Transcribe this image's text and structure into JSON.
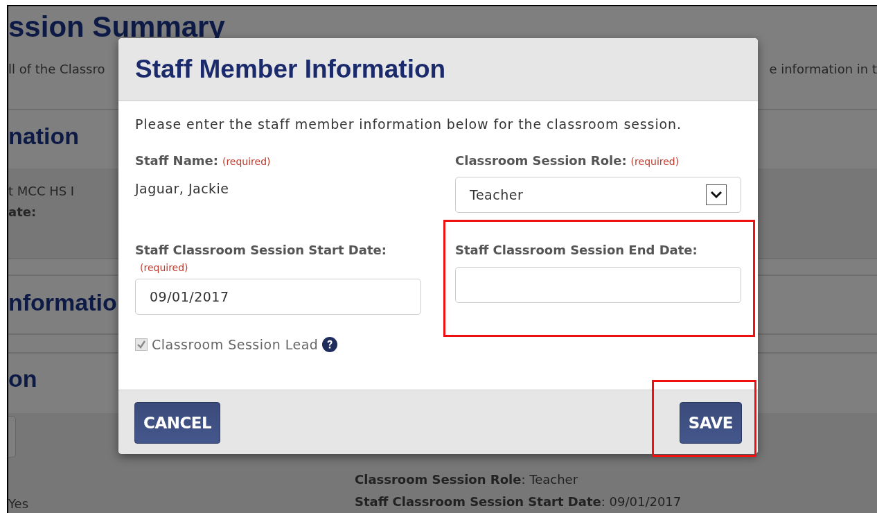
{
  "page": {
    "title": "ssion Summary",
    "intro": [
      "ll of the Classro",
      "e information in t"
    ],
    "headings": [
      "nation",
      "nformatio",
      "on"
    ],
    "details": [
      "t MCC HS I",
      "ate:"
    ],
    "value": "Yes",
    "summary": [
      "**Classroom Session Role**: Teacher",
      "**Staff Classroom Session Start Date**: 09/01/2017"
    ]
  },
  "modal": {
    "title": "Staff Member Information",
    "intro": "Please enter the staff member information below for the classroom session.",
    "fields": [
      {
        "kind": "static",
        "label": "Staff Name:",
        "required": "(required)",
        "value": "Jaguar, Jackie",
        "highlighted": false
      },
      {
        "kind": "select",
        "label": "Classroom Session Role:",
        "required": "(required)",
        "value": "Teacher",
        "highlighted": false
      },
      {
        "kind": "date",
        "label": "Staff Classroom Session Start Date:",
        "required": "(required)",
        "value": "09/01/2017",
        "highlighted": false
      },
      {
        "kind": "date",
        "label": "Staff Classroom Session End Date:",
        "highlighted": true
      }
    ],
    "lead": {
      "label": "Classroom Session Lead",
      "checked": true,
      "disabled": true
    },
    "buttons": [
      {
        "label": "CANCEL",
        "highlighted": false
      },
      {
        "label": "SAVE",
        "highlighted": true
      }
    ]
  }
}
